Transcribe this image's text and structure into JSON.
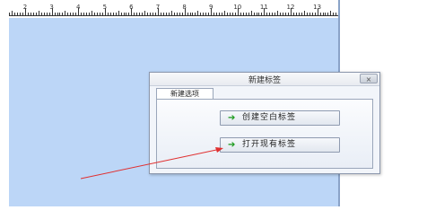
{
  "ruler": {
    "labels": [
      "2",
      "3",
      "4",
      "5",
      "6",
      "7",
      "8",
      "9",
      "10",
      "11",
      "12",
      "13"
    ]
  },
  "dialog": {
    "title": "新建标签",
    "close_label": "×",
    "tab_label": "新建选项",
    "buttons": [
      {
        "label": "创建空白标签",
        "icon": "green-arrow-icon"
      },
      {
        "label": "打开现有标签",
        "icon": "green-arrow-icon"
      }
    ]
  },
  "colors": {
    "canvas": "#bcd6f7",
    "pointer_line": "#e03030",
    "arrow": "#1a9a1a"
  }
}
